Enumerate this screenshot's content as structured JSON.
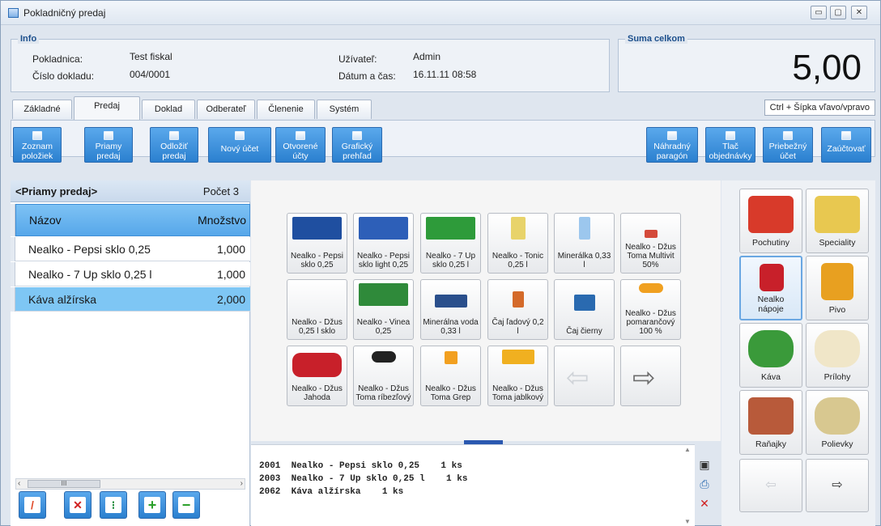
{
  "window": {
    "title": "Pokladničný predaj",
    "minimize_label": "▭",
    "maximize_label": "▢",
    "close_label": "✕"
  },
  "info": {
    "group_label": "Info",
    "pokladnica_label": "Pokladnica:",
    "pokladnica_value": "Test fiskal",
    "cislo_label": "Číslo dokladu:",
    "cislo_value": "004/0001",
    "uzivatel_label": "Užívateľ:",
    "uzivatel_value": "Admin",
    "datum_label": "Dátum a čas:",
    "datum_value": "16.11.11 08:58"
  },
  "total": {
    "group_label": "Suma celkom",
    "value": "5,00"
  },
  "tabs": [
    {
      "label": "Základné"
    },
    {
      "label": "Predaj"
    },
    {
      "label": "Doklad"
    },
    {
      "label": "Odberateľ"
    },
    {
      "label": "Členenie"
    },
    {
      "label": "Systém"
    }
  ],
  "shortcut_hint": "Ctrl + Šípka vľavo/vpravo",
  "ribbon": {
    "zoznam_poloziek_1": "Zoznam",
    "zoznam_poloziek_2": "položiek",
    "priamy_predaj_1": "Priamy",
    "priamy_predaj_2": "predaj",
    "odlozit_predaj_1": "Odložiť",
    "odlozit_predaj_2": "predaj",
    "novy_ucet": "Nový účet",
    "otvorene_ucty_1": "Otvorené",
    "otvorene_ucty_2": "účty",
    "graficky_prehlad_1": "Grafický",
    "graficky_prehlad_2": "prehľad",
    "nahradny_paragon_1": "Náhradný",
    "nahradny_paragon_2": "paragón",
    "tlac_objednavky_1": "Tlač",
    "tlac_objednavky_2": "objednávky",
    "priebezny_ucet_1": "Priebežný",
    "priebezny_ucet_2": "účet",
    "zauctovat": "Zaúčtovať"
  },
  "left_panel": {
    "title": "<Priamy predaj>",
    "count": "Počet 3",
    "col_name": "Názov",
    "col_qty": "Množstvo",
    "rows": [
      {
        "name": "Nealko - Pepsi sklo 0,25",
        "qty": "1,000"
      },
      {
        "name": "Nealko - 7 Up sklo 0,25 l",
        "qty": "1,000"
      },
      {
        "name": "Káva alžírska",
        "qty": "2,000"
      }
    ],
    "scroll_left": "‹",
    "scroll_right": "›",
    "scroll_thumb": "III"
  },
  "products": [
    {
      "label": "Nealko - Pepsi sklo 0,25",
      "color": "#1f4fa0"
    },
    {
      "label": "Nealko - Pepsi sklo light 0,25",
      "color": "#2d5fb8"
    },
    {
      "label": "Nealko - 7 Up sklo 0,25 l",
      "color": "#2e9b3a"
    },
    {
      "label": "Nealko - Tonic 0,25 l",
      "color": "#e8d36a"
    },
    {
      "label": "Minerálka 0,33 l",
      "color": "#9cc7ee"
    },
    {
      "label": "Nealko - Džus Toma Multivit 50%",
      "color": "#d44a3a"
    },
    {
      "label": "Nealko - Džus 0,25 l sklo",
      "color": "#e8e8e8"
    },
    {
      "label": "Nealko - Vinea 0,25",
      "color": "#2f8a3a"
    },
    {
      "label": "Minerálna voda 0,33 l",
      "color": "#2a4f8c"
    },
    {
      "label": "Čaj ľadový 0,2 l",
      "color": "#d46a2a"
    },
    {
      "label": "Čaj čierny",
      "color": "#2a6ab0"
    },
    {
      "label": "Nealko - Džus pomarančový 100 %",
      "color": "#f0a020"
    },
    {
      "label": "Nealko - Džus Jahoda",
      "color": "#c8202a"
    },
    {
      "label": "Nealko - Džus Toma ríbezľový",
      "color": "#222222"
    },
    {
      "label": "Nealko - Džus Toma Grep",
      "color": "#f2a020"
    },
    {
      "label": "Nealko - Džus Toma jablkový",
      "color": "#f0b020"
    }
  ],
  "receipt_lines": [
    "2001  Nealko - Pepsi sklo 0,25    1 ks",
    "2003  Nealko - 7 Up sklo 0,25 l    1 ks",
    "2062  Káva alžírska    1 ks"
  ],
  "categories": [
    {
      "label": "Pochutiny",
      "color": "#d83a2a"
    },
    {
      "label": "Speciality",
      "color": "#e8c850"
    },
    {
      "label": "Nealko nápoje",
      "color": "#c8202a"
    },
    {
      "label": "Pivo",
      "color": "#e8a020"
    },
    {
      "label": "Káva",
      "color": "#3a9a3a"
    },
    {
      "label": "Prílohy",
      "color": "#f0e6c8"
    },
    {
      "label": "Raňajky",
      "color": "#b85a3a"
    },
    {
      "label": "Polievky",
      "color": "#d8c890"
    }
  ],
  "category_nav": {
    "prev": "⇦",
    "next": "⇨"
  }
}
